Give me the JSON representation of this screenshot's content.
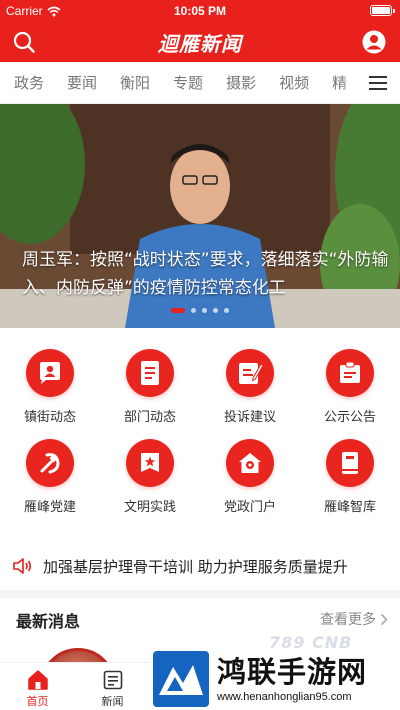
{
  "status_bar": {
    "carrier": "Carrier",
    "time": "10:05 PM"
  },
  "header": {
    "title": "迴雁新闻"
  },
  "tabs": [
    "政务",
    "要闻",
    "衡阳",
    "专题",
    "摄影",
    "视频",
    "精"
  ],
  "banner": {
    "headline": "周玉军：按照“战时状态”要求，落细落实“外防输入、内防反弹”的疫情防控常态化工",
    "slide_count": 5,
    "active_slide": 1
  },
  "quick_links": [
    {
      "label": "镇街动态",
      "icon": "person-icon"
    },
    {
      "label": "部门动态",
      "icon": "document-icon"
    },
    {
      "label": "投诉建议",
      "icon": "edit-icon"
    },
    {
      "label": "公示公告",
      "icon": "clipboard-icon"
    },
    {
      "label": "雁峰党建",
      "icon": "party-emblem-icon"
    },
    {
      "label": "文明实践",
      "icon": "star-banner-icon"
    },
    {
      "label": "党政门户",
      "icon": "home-icon"
    },
    {
      "label": "雁峰智库",
      "icon": "book-icon"
    }
  ],
  "notice": {
    "text": "加强基层护理骨干培训 助力护理服务质量提升"
  },
  "latest": {
    "title": "最新消息",
    "more": "查看更多"
  },
  "bottom_nav": [
    {
      "label": "首页",
      "active": true
    },
    {
      "label": "新闻",
      "active": false
    }
  ],
  "watermark": {
    "name": "鸿联手游网",
    "url": "www.henanhonglian95.com",
    "ghost_text": "789 CNB"
  },
  "colors": {
    "brand_red": "#e8211d",
    "tab_text": "#777777",
    "muted": "#888888"
  }
}
